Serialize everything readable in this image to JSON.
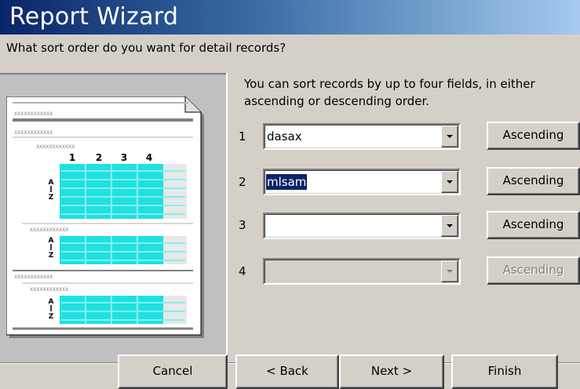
{
  "window": {
    "title": "Report Wizard"
  },
  "prompt": {
    "question": "What sort order do you want for detail records?"
  },
  "instructions": "You can sort records by up to four fields, in either ascending or descending order.",
  "sort_rows": [
    {
      "num": "1",
      "field": "dasax",
      "order": "Ascending",
      "enabled": true,
      "selected": false
    },
    {
      "num": "2",
      "field": "mlsam",
      "order": "Ascending",
      "enabled": true,
      "selected": true
    },
    {
      "num": "3",
      "field": "",
      "order": "Ascending",
      "enabled": true,
      "selected": false
    },
    {
      "num": "4",
      "field": "",
      "order": "Ascending",
      "enabled": false,
      "selected": false
    }
  ],
  "preview": {
    "column_numbers": [
      "1",
      "2",
      "3",
      "4"
    ],
    "placeholder": "XXXXXXXXXXXX",
    "accent_color": "#20e0e0"
  },
  "buttons": {
    "cancel": "Cancel",
    "back": "< Back",
    "next": "Next >",
    "finish": "Finish"
  },
  "icons": {
    "dropdown": "chevron-down-icon",
    "sort_glyph": "sort-az-icon"
  }
}
